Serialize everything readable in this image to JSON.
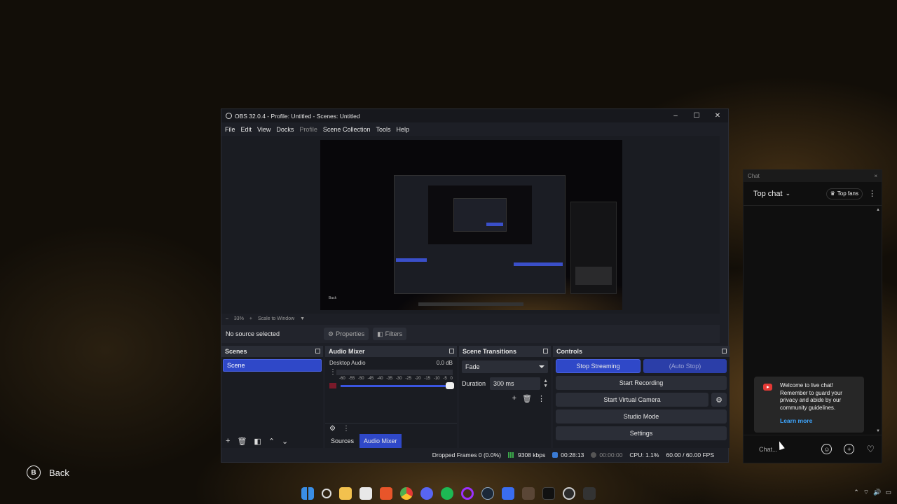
{
  "obs": {
    "title": "OBS 32.0.4 - Profile: Untitled - Scenes: Untitled",
    "window_controls": {
      "minimize": "–",
      "maximize": "☐",
      "close": "✕"
    },
    "menu": [
      "File",
      "Edit",
      "View",
      "Docks",
      "Profile",
      "Scene Collection",
      "Tools",
      "Help"
    ],
    "zoom": {
      "minus": "–",
      "value": "33%",
      "plus": "+",
      "mode": "Scale to Window",
      "caret": "▼"
    },
    "context": {
      "no_source": "No source selected",
      "properties": "Properties",
      "filters": "Filters"
    },
    "scenes": {
      "title": "Scenes",
      "items": [
        "Scene"
      ]
    },
    "audio_mixer": {
      "title": "Audio Mixer",
      "track_name": "Desktop Audio",
      "track_level": "0.0 dB",
      "scale": [
        "-60",
        "-55",
        "-50",
        "-45",
        "-40",
        "-35",
        "-30",
        "-25",
        "-20",
        "-15",
        "-10",
        "-5",
        "0"
      ]
    },
    "tabs": [
      "Sources",
      "Audio Mixer"
    ],
    "transitions": {
      "title": "Scene Transitions",
      "selected": "Fade",
      "duration_label": "Duration",
      "duration_value": "300 ms"
    },
    "controls": {
      "title": "Controls",
      "stop_streaming": "Stop Streaming",
      "auto_stop": "(Auto Stop)",
      "start_recording": "Start Recording",
      "start_virtual_camera": "Start Virtual Camera",
      "studio_mode": "Studio Mode",
      "settings": "Settings"
    },
    "status": {
      "dropped_frames": "Dropped Frames 0 (0.0%)",
      "bitrate": "9308 kbps",
      "stream_time": "00:28:13",
      "rec_time": "00:00:00",
      "cpu": "CPU: 1.1%",
      "fps": "60.00 / 60.00 FPS"
    },
    "preview": {
      "back_label": "Back"
    }
  },
  "chat": {
    "window_title": "Chat",
    "close": "×",
    "mode": "Top chat",
    "top_fans": "Top fans",
    "welcome_text": "Welcome to live chat! Remember to guard your privacy and abide by our community guidelines.",
    "learn_more": "Learn more",
    "input_placeholder": "Chat..."
  },
  "overlay": {
    "back_key": "B",
    "back_label": "Back"
  },
  "taskbar_icons": [
    {
      "name": "windows-start-icon",
      "color": "#3a8ee6"
    },
    {
      "name": "search-icon",
      "color": "#dddddd"
    },
    {
      "name": "file-explorer-icon",
      "color": "#f2c14e"
    },
    {
      "name": "store-icon",
      "color": "#e8e8e8"
    },
    {
      "name": "brave-icon",
      "color": "#e8552a"
    },
    {
      "name": "chrome-icon",
      "color": "#4caf50"
    },
    {
      "name": "discord-icon",
      "color": "#5865f2"
    },
    {
      "name": "spotify-icon",
      "color": "#1db954"
    },
    {
      "name": "circle-app-icon",
      "color": "#9b30ff"
    },
    {
      "name": "steam-icon",
      "color": "#1b2838"
    },
    {
      "name": "blue-app-icon",
      "color": "#3a6df0"
    },
    {
      "name": "game-app-icon",
      "color": "#5a4636"
    },
    {
      "name": "tiktok-icon",
      "color": "#111111"
    },
    {
      "name": "obs-icon",
      "color": "#2b2b2b"
    },
    {
      "name": "app-icon",
      "color": "#333333"
    }
  ]
}
